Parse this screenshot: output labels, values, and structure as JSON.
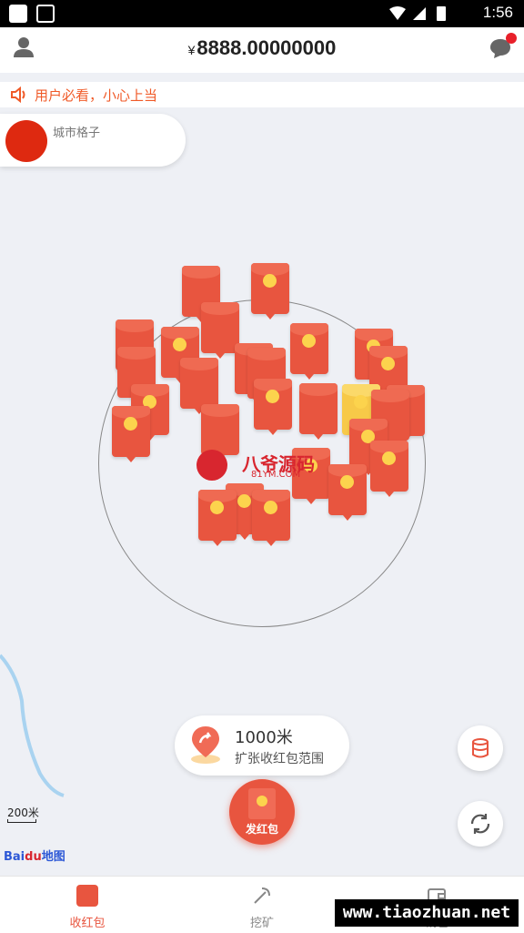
{
  "status_bar": {
    "time": "1:56"
  },
  "header": {
    "currency_symbol": "¥",
    "balance": "8888.00000000"
  },
  "notice": {
    "text": "用户必看，小心上当"
  },
  "city_card": {
    "name": "城市格子"
  },
  "watermark": {
    "brand": "八爷源码",
    "site": "81YM.COM"
  },
  "expand_card": {
    "distance": "1000米",
    "label": "扩张收红包范围"
  },
  "fab": {
    "label": "发红包"
  },
  "map": {
    "scale": "200米",
    "logo_bai": "Bai",
    "logo_du": "du",
    "logo_map": "地图"
  },
  "tabs": [
    {
      "label": "收红包",
      "icon": "red-envelope-icon",
      "active": true
    },
    {
      "label": "挖矿",
      "icon": "pickaxe-icon",
      "active": false
    },
    {
      "label": "钱包",
      "icon": "wallet-icon",
      "active": false
    }
  ],
  "banner": {
    "text": "www.tiaozhuan.net"
  },
  "colors": {
    "accent": "#e8553f",
    "notice": "#f05a28",
    "gold": "#fcd34d"
  }
}
